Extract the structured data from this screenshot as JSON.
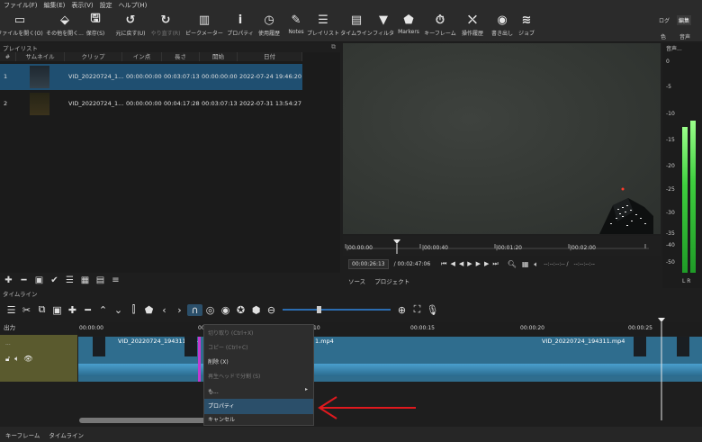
{
  "menu": [
    "ファイル(F)",
    "編集(E)",
    "表示(V)",
    "設定",
    "ヘルプ(H)"
  ],
  "toolbar": {
    "items": [
      {
        "label": "ファイルを開く(O)",
        "icon": "folder-icon"
      },
      {
        "label": "その他を開く...",
        "icon": "open-other-icon"
      },
      {
        "label": "保存(S)",
        "icon": "save-icon"
      },
      {
        "label": "元に戻す(U)",
        "icon": "undo-icon"
      },
      {
        "label": "やり直す(R)",
        "icon": "redo-icon"
      },
      {
        "label": "ピークメーター",
        "icon": "peak-meter-icon"
      },
      {
        "label": "プロパティ",
        "icon": "info-icon"
      },
      {
        "label": "使用履歴",
        "icon": "history-icon"
      },
      {
        "label": "Notes",
        "icon": "notes-icon"
      },
      {
        "label": "プレイリスト",
        "icon": "playlist-icon"
      },
      {
        "label": "タイムライン",
        "icon": "timeline-icon"
      },
      {
        "label": "フィルタ",
        "icon": "filter-icon"
      },
      {
        "label": "Markers",
        "icon": "marker-icon"
      },
      {
        "label": "キーフレーム",
        "icon": "keyframe-icon"
      },
      {
        "label": "操作履歴",
        "icon": "jobs-history-icon"
      },
      {
        "label": "書き出し",
        "icon": "export-icon"
      },
      {
        "label": "ジョブ",
        "icon": "jobs-icon"
      }
    ],
    "right_labels": {
      "log": "ログ",
      "edit": "編集",
      "color": "色",
      "audio": "音声"
    }
  },
  "playlist": {
    "title": "プレイリスト",
    "columns": [
      "#",
      "サムネイル",
      "クリップ",
      "イン点",
      "長さ",
      "開始",
      "日付"
    ],
    "rows": [
      {
        "num": "1",
        "clip": "VID_20220724_1...",
        "in": "00:00:00:00",
        "duration": "00:03:07:13",
        "start": "00:00:00:00",
        "date": "2022-07-24 19:46:20"
      },
      {
        "num": "2",
        "clip": "VID_20220724_1...",
        "in": "00:00:00:00",
        "duration": "00:04:17:28",
        "start": "00:03:07:13",
        "date": "2022-07-31 13:54:27"
      }
    ]
  },
  "viewer": {
    "ruler_labels": [
      "|00:00:00",
      "|00:00:40",
      "|00:01:20",
      "|00:02:00"
    ],
    "current_time": "00:00:26:13",
    "total_time": "/ 00:02:47:06",
    "in_point": "--:--:--:-- /",
    "out_point": "--:--:--:--",
    "tabs": [
      "ソース",
      "プロジェクト"
    ]
  },
  "meter": {
    "title": "音声...",
    "scale": [
      "0",
      "-5",
      "-10",
      "-15",
      "-20",
      "-25",
      "-30",
      "-35",
      "-40",
      "-50"
    ],
    "channels": "L R"
  },
  "timeline": {
    "title": "タイムライン",
    "track_label": "出力",
    "ruler_labels": [
      "00:00:00",
      "00:00",
      "10",
      "00:00:15",
      "00:00:20",
      "00:00:25"
    ],
    "clips": [
      "VID_20220724_194311.mp4",
      "1.mp4",
      "VID_20220724_194311.mp4"
    ]
  },
  "context_menu": {
    "items": [
      {
        "label": "切り取り (Ctrl+X)",
        "disabled": true
      },
      {
        "label": "コピー (Ctrl+C)",
        "disabled": true
      },
      {
        "label": "削除 (X)",
        "disabled": false
      },
      {
        "label": "再生ヘッドで分割 (S)",
        "disabled": true
      },
      {
        "label": "も...",
        "disabled": false
      },
      {
        "label": "プロパティ",
        "disabled": false,
        "selected": true
      },
      {
        "label": "キャンセル",
        "disabled": false
      }
    ]
  },
  "bottom_tabs": [
    "キーフレーム",
    "タイムライン"
  ],
  "colors": {
    "accent": "#2b4f6a",
    "clip": "#2f6d8e",
    "arrow": "#e0191e",
    "track": "#5a5a2e"
  }
}
